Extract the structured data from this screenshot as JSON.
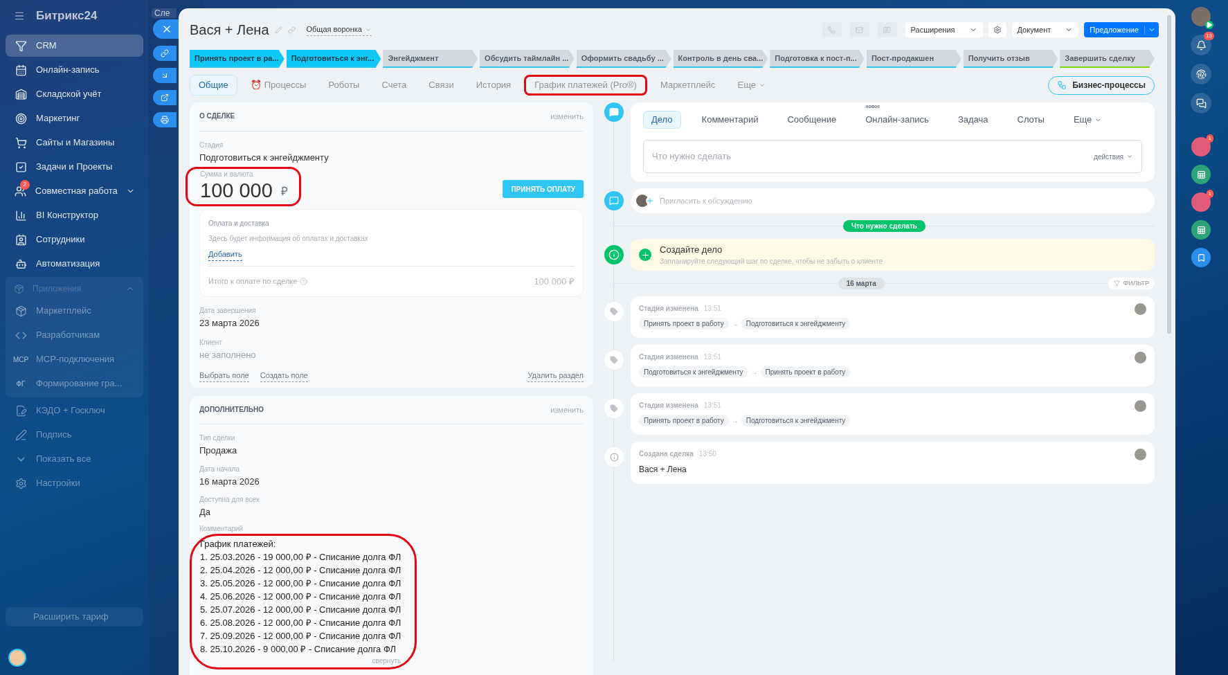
{
  "behind": {
    "search_text": "Сле"
  },
  "sidebar": {
    "logo": "Битрикс24",
    "items": [
      {
        "kind": "link",
        "label": "CRM",
        "selected": true,
        "dimmed": false
      },
      {
        "kind": "link",
        "label": "Онлайн-запись",
        "selected": false,
        "dimmed": false
      },
      {
        "kind": "link",
        "label": "Складской учёт",
        "selected": false,
        "dimmed": false
      },
      {
        "kind": "link",
        "label": "Маркетинг",
        "selected": false,
        "dimmed": false
      },
      {
        "kind": "link",
        "label": "Сайты и Магазины",
        "selected": false,
        "dimmed": false
      },
      {
        "kind": "link",
        "label": "Задачи и Проекты",
        "selected": false,
        "dimmed": false
      },
      {
        "kind": "link",
        "label": "Совместная работа",
        "selected": false,
        "dimmed": false,
        "badge": "2",
        "expanded": false
      },
      {
        "kind": "link",
        "label": "BI Конструктор",
        "selected": false,
        "dimmed": false
      },
      {
        "kind": "link",
        "label": "Сотрудники",
        "selected": false,
        "dimmed": false
      },
      {
        "kind": "link",
        "label": "Автоматизация",
        "selected": false,
        "dimmed": false
      },
      {
        "kind": "group",
        "label": "Приложения",
        "expanded": true,
        "children": [
          {
            "kind": "link",
            "label": "Маркетплейс",
            "selected": false,
            "dimmed": true
          },
          {
            "kind": "link",
            "label": "Разработчикам",
            "selected": false,
            "dimmed": true
          },
          {
            "kind": "link",
            "label": "MCP-подключения",
            "selected": false,
            "dimmed": true,
            "icon_text": "MCP"
          },
          {
            "kind": "link",
            "label": "Формирование гра...",
            "selected": false,
            "dimmed": true,
            "icon_text": "ФГ"
          }
        ]
      },
      {
        "kind": "link",
        "label": "КЭДО + Госключ",
        "selected": false,
        "dimmed": true
      },
      {
        "kind": "link",
        "label": "Подпись",
        "selected": false,
        "dimmed": true
      },
      {
        "kind": "link",
        "label": "Показать все",
        "selected": false,
        "dimmed": true
      },
      {
        "kind": "link",
        "label": "Настройки",
        "selected": false,
        "dimmed": true
      }
    ],
    "upgrade": "Расширить тариф"
  },
  "deal": {
    "title": "Вася + Лена",
    "funnel": "Общая воронка",
    "header_buttons": [
      {
        "kind": "dropdown",
        "label": "Расширения"
      },
      {
        "kind": "settings"
      },
      {
        "kind": "dropdown",
        "label": "Документ"
      },
      {
        "kind": "primary",
        "label": "Предложение"
      }
    ],
    "stages": [
      {
        "label": "Принять проект в ра...",
        "reached": true,
        "color": "#2fc6f6"
      },
      {
        "label": "Подготовиться к энг...",
        "reached": true,
        "color": "#2fc6f6"
      },
      {
        "label": "Энгейджмент",
        "reached": false,
        "color": "#2fc6f6"
      },
      {
        "label": "Обсудить таймлайн ...",
        "reached": false,
        "color": "#2fc6f6"
      },
      {
        "label": "Оформить свадьбу ...",
        "reached": false,
        "color": "#2fc6f6"
      },
      {
        "label": "Контроль в день сва...",
        "reached": false,
        "color": "#2fc6f6"
      },
      {
        "label": "Подготовка к пост-п...",
        "reached": false,
        "color": "#2fc6f6"
      },
      {
        "label": "Пост-продакшен",
        "reached": false,
        "color": "#2fc6f6"
      },
      {
        "label": "Получить отзыв",
        "reached": false,
        "color": "#2fc6f6"
      },
      {
        "label": "Завершить сделку",
        "reached": false,
        "color": "#7bd500"
      }
    ],
    "tabs": [
      {
        "label": "Общие",
        "selected": true,
        "annotated": false
      },
      {
        "label": "Процессы",
        "selected": false,
        "annotated": false,
        "emoji": "⏰"
      },
      {
        "label": "Роботы",
        "selected": false,
        "annotated": false
      },
      {
        "label": "Счета",
        "selected": false,
        "annotated": false
      },
      {
        "label": "Связи",
        "selected": false,
        "annotated": false
      },
      {
        "label": "История",
        "selected": false,
        "annotated": false
      },
      {
        "label": "График платежей (Pro®)",
        "selected": false,
        "annotated": true
      },
      {
        "label": "Маркетплейс",
        "selected": false,
        "annotated": false
      },
      {
        "label": "Еще",
        "selected": false,
        "annotated": false,
        "menu": true
      }
    ],
    "bp_button": "Бизнес-процессы",
    "about": {
      "heading": "О СДЕЛКЕ",
      "edit": "изменить",
      "stage_label": "Стадия",
      "stage_value": "Подготовиться к энгейджменту",
      "sum_label": "Сумма и валюта",
      "amount": "100 000",
      "currency": "₽",
      "sum_annotated": true,
      "pay_button": "ПРИНЯТЬ ОПЛАТУ",
      "payment": {
        "title": "Оплата и доставка",
        "hint": "Здесь будет информация об оплатах и доставках",
        "add": "Добавить",
        "total_label": "Итого к оплате по сделке",
        "total": "100 000 ₽"
      },
      "fields": [
        {
          "label": "Дата завершения",
          "value": "23 марта 2026",
          "empty": false
        },
        {
          "label": "Клиент",
          "value": "не заполнено",
          "empty": true
        }
      ],
      "links": [
        "Выбрать поле",
        "Создать поле"
      ],
      "delete": "Удалить раздел"
    },
    "extra": {
      "heading": "ДОПОЛНИТЕЛЬНО",
      "edit": "изменить",
      "fields": [
        {
          "label": "Тип сделки",
          "value": "Продажа"
        },
        {
          "label": "Дата начала",
          "value": "16 марта 2026"
        },
        {
          "label": "Доступна для всех",
          "value": "Да"
        }
      ],
      "comment_label": "Комментарий",
      "comment_annotated": true,
      "comment_lines": [
        "График платежей:",
        "1. 25.03.2026 - 19 000,00 ₽ - Списание долга ФЛ",
        "2. 25.04.2026 - 12 000,00 ₽ - Списание долга ФЛ",
        "3. 25.05.2026 - 12 000,00 ₽ - Списание долга ФЛ",
        "4. 25.06.2026 - 12 000,00 ₽ - Списание долга ФЛ",
        "5. 25.07.2026 - 12 000,00 ₽ - Списание долга ФЛ",
        "6. 25.08.2026 - 12 000,00 ₽ - Списание долга ФЛ",
        "7. 25.09.2026 - 12 000,00 ₽ - Списание долга ФЛ",
        "8. 25.10.2026 - 9 000,00 ₽ - Списание долга ФЛ"
      ],
      "collapse": "свернуть"
    }
  },
  "timeline": {
    "tabs": [
      {
        "label": "Дело",
        "selected": true
      },
      {
        "label": "Комментарий",
        "selected": false
      },
      {
        "label": "Сообщение",
        "selected": false
      },
      {
        "label": "Онлайн-запись",
        "selected": false,
        "badge": "новое"
      },
      {
        "label": "Задача",
        "selected": false
      },
      {
        "label": "Слоты",
        "selected": false
      },
      {
        "label": "Еще",
        "selected": false,
        "menu": true
      }
    ],
    "input_placeholder": "Что нужно сделать",
    "actions": "действия",
    "invite_placeholder": "Пригласить к обсуждению",
    "todo_pill": "Что нужно сделать",
    "todo": {
      "title": "Создайте дело",
      "text": "Запланируйте следующий шаг по сделке, чтобы не забыть о клиенте"
    },
    "date": "16 марта",
    "filter": "ФИЛЬТР",
    "events": [
      {
        "kind": "stage",
        "title": "Стадия изменена",
        "time": "13:51",
        "from": "Принять проект в работу",
        "arrow": "→",
        "to": "Подготовиться к энгейджменту"
      },
      {
        "kind": "stage",
        "title": "Стадия изменена",
        "time": "13:51",
        "from": "Подготовиться к энгейджменту",
        "arrow": "→",
        "to": "Принять проект в работу"
      },
      {
        "kind": "stage",
        "title": "Стадия изменена",
        "time": "13:51",
        "from": "Принять проект в работу",
        "arrow": "→",
        "to": "Подготовиться к энгейджменту"
      },
      {
        "kind": "created",
        "title": "Создана сделка",
        "time": "13:50",
        "text": "Вася + Лена"
      }
    ]
  },
  "right_bar": {
    "notifications": "13",
    "badges": [
      "1",
      "1"
    ]
  }
}
